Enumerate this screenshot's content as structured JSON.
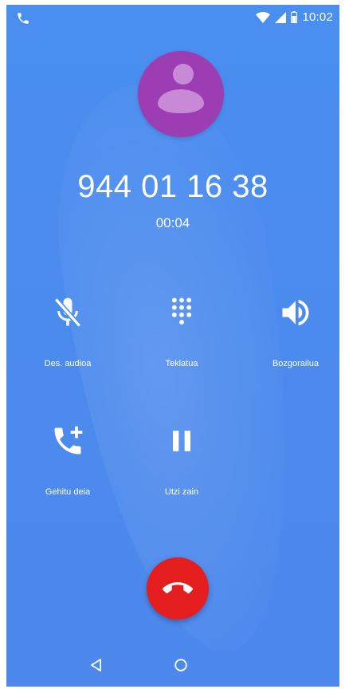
{
  "status_bar": {
    "time": "10:02",
    "icons": [
      "phone-call-icon",
      "wifi-icon",
      "signal-icon",
      "battery-icon"
    ]
  },
  "call": {
    "number": "944 01 16 38",
    "duration": "00:04"
  },
  "buttons": {
    "mute": {
      "label": "Des. audioa",
      "icon": "mic-off-icon"
    },
    "keypad": {
      "label": "Teklatua",
      "icon": "dialpad-icon"
    },
    "speaker": {
      "label": "Bozgorailua",
      "icon": "speaker-icon"
    },
    "add_call": {
      "label": "Gehitu deia",
      "icon": "add-call-icon"
    },
    "hold": {
      "label": "Utzi zain",
      "icon": "pause-icon"
    },
    "end_call": {
      "icon": "end-call-icon"
    }
  },
  "nav": {
    "icons": [
      "back-icon",
      "home-icon"
    ]
  },
  "colors": {
    "background": "#4a8ef0",
    "avatar": "#9c3db3",
    "end_call": "#e41e1e"
  }
}
